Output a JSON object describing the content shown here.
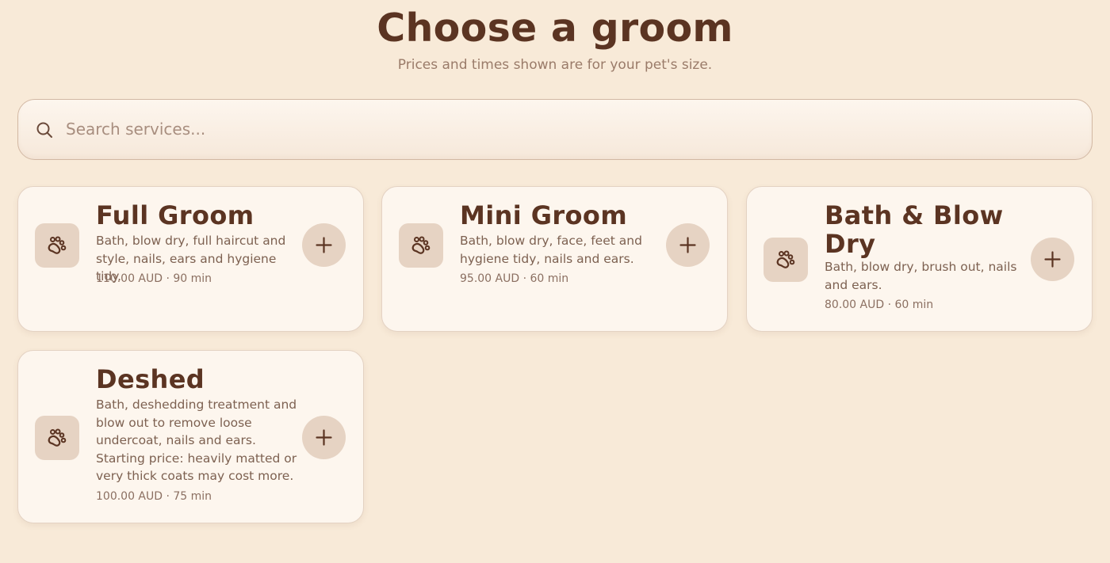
{
  "header": {
    "title": "Choose a groom",
    "subtitle": "Prices and times shown are for your pet's size."
  },
  "search": {
    "placeholder": "Search services...",
    "value": "",
    "icon": "search-icon"
  },
  "services": [
    {
      "title": "Full Groom",
      "description": "Bath, blow dry, full haircut and style, nails, ears and hygiene tidy.",
      "meta": "110.00 AUD · 90 min",
      "icon": "paw-icon",
      "action_icon": "plus-icon"
    },
    {
      "title": "Mini Groom",
      "description": "Bath, blow dry, face, feet and hygiene tidy, nails and ears.",
      "meta": "95.00 AUD · 60 min",
      "icon": "paw-icon",
      "action_icon": "plus-icon"
    },
    {
      "title": "Bath & Blow Dry",
      "description": "Bath, blow dry, brush out, nails and ears.",
      "meta": "80.00 AUD · 60 min",
      "icon": "paw-icon",
      "action_icon": "plus-icon"
    },
    {
      "title": "Deshed",
      "description": "Bath, deshedding treatment and blow out to remove loose undercoat, nails and ears. Starting price: heavily matted or very thick coats may cost more.",
      "meta": "100.00 AUD · 75 min",
      "icon": "paw-icon",
      "action_icon": "plus-icon"
    }
  ],
  "colors": {
    "background": "#f8ead8",
    "card": "#fdf6ee",
    "accent": "#5b3422",
    "icon_bg": "#e6d3c3"
  }
}
